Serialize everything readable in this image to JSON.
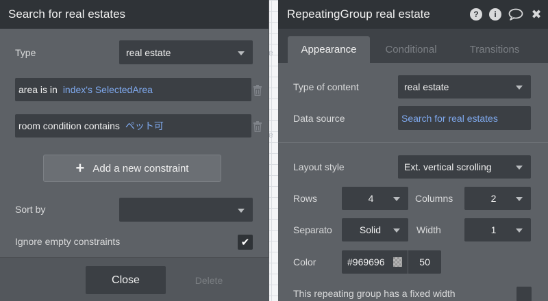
{
  "left_panel": {
    "title": "Search for real estates",
    "type_label": "Type",
    "type_value": "real estate",
    "constraints": [
      {
        "field": "area is in",
        "value": "index's SelectedArea"
      },
      {
        "field": "room condition contains",
        "value": "ペット可"
      }
    ],
    "add_constraint_label": "Add a new constraint",
    "sort_by_label": "Sort by",
    "sort_by_value": "",
    "ignore_empty_label": "Ignore empty constraints",
    "ignore_empty_checked": true,
    "close_label": "Close",
    "delete_label": "Delete"
  },
  "right_panel": {
    "title": "RepeatingGroup real estate",
    "header_icons": [
      "help-icon",
      "info-icon",
      "comment-icon",
      "close-icon"
    ],
    "tabs": [
      {
        "label": "Appearance",
        "active": true
      },
      {
        "label": "Conditional",
        "active": false
      },
      {
        "label": "Transitions",
        "active": false
      }
    ],
    "type_of_content_label": "Type of content",
    "type_of_content_value": "real estate",
    "data_source_label": "Data source",
    "data_source_value": "Search for real estates",
    "layout_style_label": "Layout style",
    "layout_style_value": "Ext. vertical scrolling",
    "rows_label": "Rows",
    "rows_value": "4",
    "columns_label": "Columns",
    "columns_value": "2",
    "separator_label": "Separato",
    "separator_value": "Solid",
    "width_label": "Width",
    "width_value": "1",
    "color_label": "Color",
    "color_hex": "#969696",
    "color_opacity": "50",
    "fixed_width_label": "This repeating group has a fixed width"
  },
  "colors": {
    "panel_bg": "#5d6166",
    "header_bg": "#2f3337",
    "input_bg": "#3b3f44",
    "dynamic_link": "#7fa9ee"
  }
}
